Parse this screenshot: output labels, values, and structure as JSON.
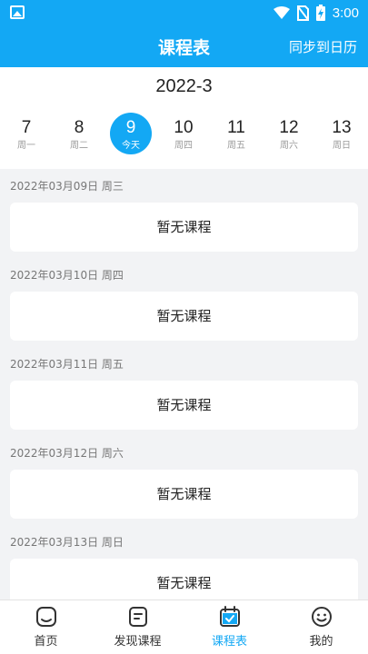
{
  "status": {
    "time": "3:00"
  },
  "header": {
    "title": "课程表",
    "sync_label": "同步到日历"
  },
  "calendar": {
    "month": "2022-3",
    "days": [
      {
        "num": "7",
        "label": "周一"
      },
      {
        "num": "8",
        "label": "周二"
      },
      {
        "num": "9",
        "label": "今天",
        "selected": true
      },
      {
        "num": "10",
        "label": "周四"
      },
      {
        "num": "11",
        "label": "周五"
      },
      {
        "num": "12",
        "label": "周六"
      },
      {
        "num": "13",
        "label": "周日"
      }
    ]
  },
  "schedule": [
    {
      "date": "2022年03月09日 周三",
      "empty_text": "暂无课程"
    },
    {
      "date": "2022年03月10日 周四",
      "empty_text": "暂无课程"
    },
    {
      "date": "2022年03月11日 周五",
      "empty_text": "暂无课程"
    },
    {
      "date": "2022年03月12日 周六",
      "empty_text": "暂无课程"
    },
    {
      "date": "2022年03月13日 周日",
      "empty_text": "暂无课程"
    }
  ],
  "tabs": [
    {
      "label": "首页",
      "icon": "home-icon"
    },
    {
      "label": "发现课程",
      "icon": "discover-icon"
    },
    {
      "label": "课程表",
      "icon": "calendar-icon",
      "active": true
    },
    {
      "label": "我的",
      "icon": "smiley-icon"
    }
  ],
  "colors": {
    "primary": "#13a8f4",
    "background": "#f2f3f5",
    "text": "#222222",
    "muted": "#9a9a9a"
  }
}
